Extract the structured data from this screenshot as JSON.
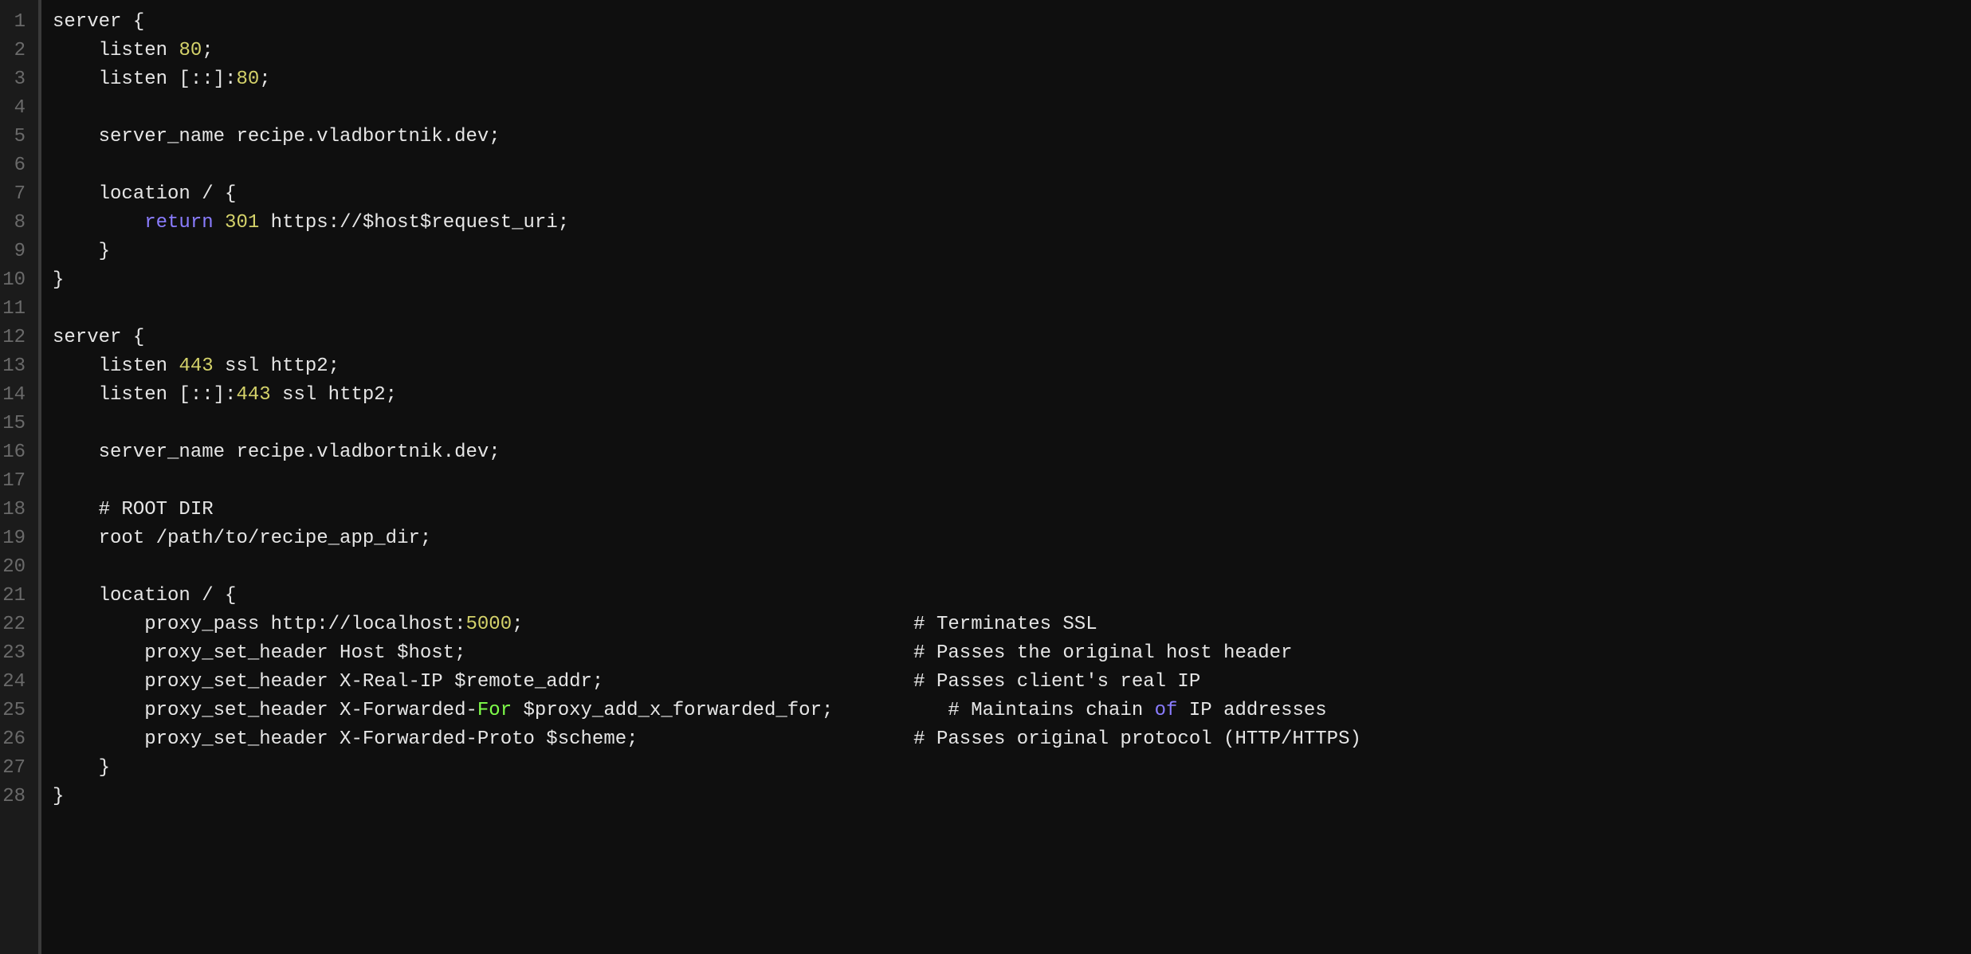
{
  "language": "nginx",
  "font": "monospace",
  "gutter": {
    "start": 1,
    "end": 28
  },
  "tokens": {
    "return": "return",
    "of": "of",
    "for": "For"
  },
  "lines": [
    [
      {
        "t": "server {"
      }
    ],
    [
      {
        "t": "    listen "
      },
      {
        "t": "80",
        "c": "tok-num"
      },
      {
        "t": ";"
      }
    ],
    [
      {
        "t": "    listen [::]:"
      },
      {
        "t": "80",
        "c": "tok-num"
      },
      {
        "t": ";"
      }
    ],
    [
      {
        "t": ""
      }
    ],
    [
      {
        "t": "    server_name recipe.vladbortnik.dev;"
      }
    ],
    [
      {
        "t": ""
      }
    ],
    [
      {
        "t": "    location / {"
      }
    ],
    [
      {
        "t": "        "
      },
      {
        "t": "return",
        "c": "tok-key"
      },
      {
        "t": " "
      },
      {
        "t": "301",
        "c": "tok-num"
      },
      {
        "t": " https://$host$request_uri;"
      }
    ],
    [
      {
        "t": "    }"
      }
    ],
    [
      {
        "t": "}"
      }
    ],
    [
      {
        "t": ""
      }
    ],
    [
      {
        "t": "server {"
      }
    ],
    [
      {
        "t": "    listen "
      },
      {
        "t": "443",
        "c": "tok-num"
      },
      {
        "t": " ssl http2;"
      }
    ],
    [
      {
        "t": "    listen [::]:"
      },
      {
        "t": "443",
        "c": "tok-num"
      },
      {
        "t": " ssl http2;"
      }
    ],
    [
      {
        "t": ""
      }
    ],
    [
      {
        "t": "    server_name recipe.vladbortnik.dev;"
      }
    ],
    [
      {
        "t": ""
      }
    ],
    [
      {
        "t": "    # ROOT DIR"
      }
    ],
    [
      {
        "t": "    root /path/to/recipe_app_dir;"
      }
    ],
    [
      {
        "t": ""
      }
    ],
    [
      {
        "t": "    location / {"
      }
    ],
    [
      {
        "t": "        proxy_pass http://localhost:"
      },
      {
        "t": "5000",
        "c": "tok-num"
      },
      {
        "t": ";                                  # Terminates SSL"
      }
    ],
    [
      {
        "t": "        proxy_set_header Host $host;                                       # Passes the original host header"
      }
    ],
    [
      {
        "t": "        proxy_set_header X-Real-IP $remote_addr;                           # Passes client's real IP"
      }
    ],
    [
      {
        "t": "        proxy_set_header X-Forwarded-"
      },
      {
        "t": "For",
        "c": "tok-for"
      },
      {
        "t": " $proxy_add_x_forwarded_for;          # Maintains chain "
      },
      {
        "t": "of",
        "c": "tok-of"
      },
      {
        "t": " IP addresses"
      }
    ],
    [
      {
        "t": "        proxy_set_header X-Forwarded-Proto $scheme;                        # Passes original protocol (HTTP/HTTPS)"
      }
    ],
    [
      {
        "t": "    }"
      }
    ],
    [
      {
        "t": "}"
      }
    ]
  ]
}
